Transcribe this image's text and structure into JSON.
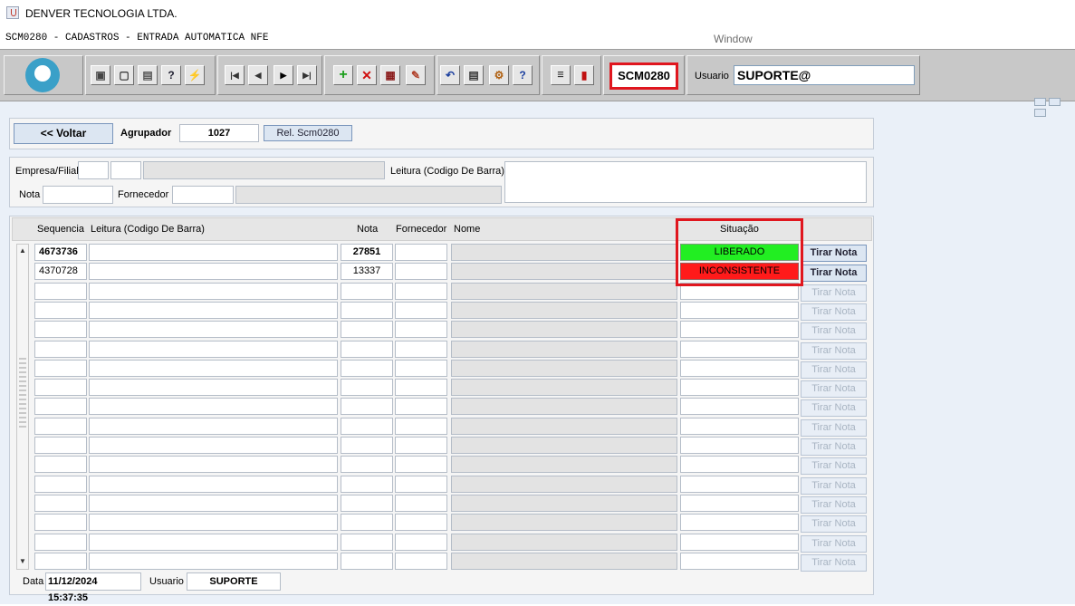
{
  "window": {
    "title": "DENVER TECNOLOGIA LTDA.",
    "form_caption": "SCM0280 - CADASTROS - ENTRADA AUTOMATICA NFE",
    "menu_window": "Window"
  },
  "toolbar": {
    "form_code": "SCM0280",
    "usuario_label": "Usuario",
    "usuario_value": "SUPORTE@"
  },
  "header": {
    "voltar_label": "<< Voltar",
    "agrupador_label": "Agrupador",
    "agrupador_value": "1027",
    "rel_button_label": "Rel. Scm0280"
  },
  "filters": {
    "empresa_label": "Empresa/Filial",
    "empresa_value": "",
    "filial_value": "",
    "empresa_name": "",
    "nota_label": "Nota",
    "nota_value": "",
    "fornecedor_label": "Fornecedor",
    "fornecedor_value": "",
    "fornecedor_name": "",
    "leitura_label": "Leitura (Codigo De Barra)",
    "leitura_value": ""
  },
  "grid": {
    "columns": {
      "sequencia": "Sequencia",
      "leitura": "Leitura (Codigo De Barra)",
      "nota": "Nota",
      "fornecedor": "Fornecedor",
      "nome": "Nome",
      "situacao": "Situação"
    },
    "tirar_label": "Tirar Nota",
    "rows": [
      {
        "sequencia": "4673736",
        "leitura": "",
        "nota": "27851",
        "fornecedor": "",
        "nome": "",
        "situacao": "LIBERADO",
        "status": "ok"
      },
      {
        "sequencia": "4370728",
        "leitura": "",
        "nota": "13337",
        "fornecedor": "",
        "nome": "",
        "situacao": "INCONSISTENTE",
        "status": "error"
      },
      {
        "sequencia": "",
        "leitura": "",
        "nota": "",
        "fornecedor": "",
        "nome": "",
        "situacao": "",
        "status": "empty"
      },
      {
        "sequencia": "",
        "leitura": "",
        "nota": "",
        "fornecedor": "",
        "nome": "",
        "situacao": "",
        "status": "empty"
      },
      {
        "sequencia": "",
        "leitura": "",
        "nota": "",
        "fornecedor": "",
        "nome": "",
        "situacao": "",
        "status": "empty"
      },
      {
        "sequencia": "",
        "leitura": "",
        "nota": "",
        "fornecedor": "",
        "nome": "",
        "situacao": "",
        "status": "empty"
      },
      {
        "sequencia": "",
        "leitura": "",
        "nota": "",
        "fornecedor": "",
        "nome": "",
        "situacao": "",
        "status": "empty"
      },
      {
        "sequencia": "",
        "leitura": "",
        "nota": "",
        "fornecedor": "",
        "nome": "",
        "situacao": "",
        "status": "empty"
      },
      {
        "sequencia": "",
        "leitura": "",
        "nota": "",
        "fornecedor": "",
        "nome": "",
        "situacao": "",
        "status": "empty"
      },
      {
        "sequencia": "",
        "leitura": "",
        "nota": "",
        "fornecedor": "",
        "nome": "",
        "situacao": "",
        "status": "empty"
      },
      {
        "sequencia": "",
        "leitura": "",
        "nota": "",
        "fornecedor": "",
        "nome": "",
        "situacao": "",
        "status": "empty"
      },
      {
        "sequencia": "",
        "leitura": "",
        "nota": "",
        "fornecedor": "",
        "nome": "",
        "situacao": "",
        "status": "empty"
      },
      {
        "sequencia": "",
        "leitura": "",
        "nota": "",
        "fornecedor": "",
        "nome": "",
        "situacao": "",
        "status": "empty"
      },
      {
        "sequencia": "",
        "leitura": "",
        "nota": "",
        "fornecedor": "",
        "nome": "",
        "situacao": "",
        "status": "empty"
      },
      {
        "sequencia": "",
        "leitura": "",
        "nota": "",
        "fornecedor": "",
        "nome": "",
        "situacao": "",
        "status": "empty"
      },
      {
        "sequencia": "",
        "leitura": "",
        "nota": "",
        "fornecedor": "",
        "nome": "",
        "situacao": "",
        "status": "empty"
      },
      {
        "sequencia": "",
        "leitura": "",
        "nota": "",
        "fornecedor": "",
        "nome": "",
        "situacao": "",
        "status": "empty"
      }
    ]
  },
  "footer": {
    "data_label": "Data",
    "data_value": "11/12/2024 15:37:35",
    "usuario_label": "Usuario",
    "usuario_value": "SUPORTE"
  },
  "colors": {
    "liberado": "#22ee22",
    "inconsistente": "#ff1a1a",
    "highlight": "#e0161e"
  }
}
